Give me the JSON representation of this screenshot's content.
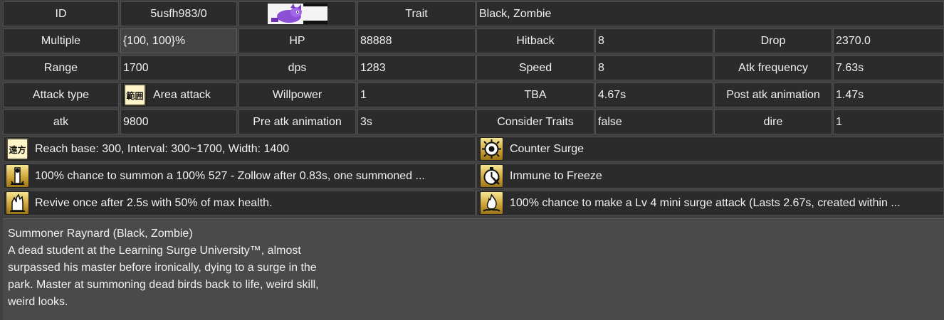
{
  "header": {
    "id_label": "ID",
    "id_value": "5usfh983/0",
    "trait_label": "Trait",
    "trait_value": "Black, Zombie"
  },
  "stats": {
    "multiple_label": "Multiple",
    "multiple_value": "{100, 100}%",
    "hp_label": "HP",
    "hp_value": "88888",
    "hitback_label": "Hitback",
    "hitback_value": "8",
    "drop_label": "Drop",
    "drop_value": "2370.0",
    "range_label": "Range",
    "range_value": "1700",
    "dps_label": "dps",
    "dps_value": "1283",
    "speed_label": "Speed",
    "speed_value": "8",
    "atk_freq_label": "Atk frequency",
    "atk_freq_value": "7.63s",
    "attack_type_label": "Attack type",
    "attack_type_icon_text": "範囲",
    "attack_type_value": "Area attack",
    "willpower_label": "Willpower",
    "willpower_value": "1",
    "tba_label": "TBA",
    "tba_value": "4.67s",
    "post_atk_label": "Post atk animation",
    "post_atk_value": "1.47s",
    "atk_label": "atk",
    "atk_value": "9800",
    "pre_atk_label": "Pre atk animation",
    "pre_atk_value": "3s",
    "consider_traits_label": "Consider Traits",
    "consider_traits_value": "false",
    "dire_label": "dire",
    "dire_value": "1"
  },
  "abilities": [
    {
      "icon": "long-distance-icon",
      "icon_text": "遠方",
      "text": "Reach base: 300, Interval: 300~1700, Width: 1400"
    },
    {
      "icon": "counter-surge-icon",
      "text": "Counter Surge"
    },
    {
      "icon": "summon-icon",
      "text": "100% chance to summon a 100% 527 - Zollow after 0.83s, one summoned ..."
    },
    {
      "icon": "freeze-immune-icon",
      "text": "Immune to Freeze"
    },
    {
      "icon": "revive-icon",
      "text": "Revive once after 2.5s with 50% of  max health."
    },
    {
      "icon": "mini-surge-icon",
      "text": "100% chance to make a Lv 4 mini surge attack (Lasts 2.67s, created within ..."
    }
  ],
  "description": {
    "lines": [
      "Summoner Raynard (Black, Zombie)",
      "A dead student at the Learning Surge University™, almost",
      "surpassed his master before ironically, dying to a surge in the",
      "park. Master at summoning dead birds back to life, weird skill,",
      "weird looks."
    ]
  },
  "colors": {
    "cell_bg": "#2b2b2b",
    "border": "#4f4f4f",
    "page_bg": "#3f3f3f",
    "desc_bg": "#4a4a4a",
    "icon_gold": "#cfa63a",
    "thumb_purple": "#8d4fd6"
  }
}
